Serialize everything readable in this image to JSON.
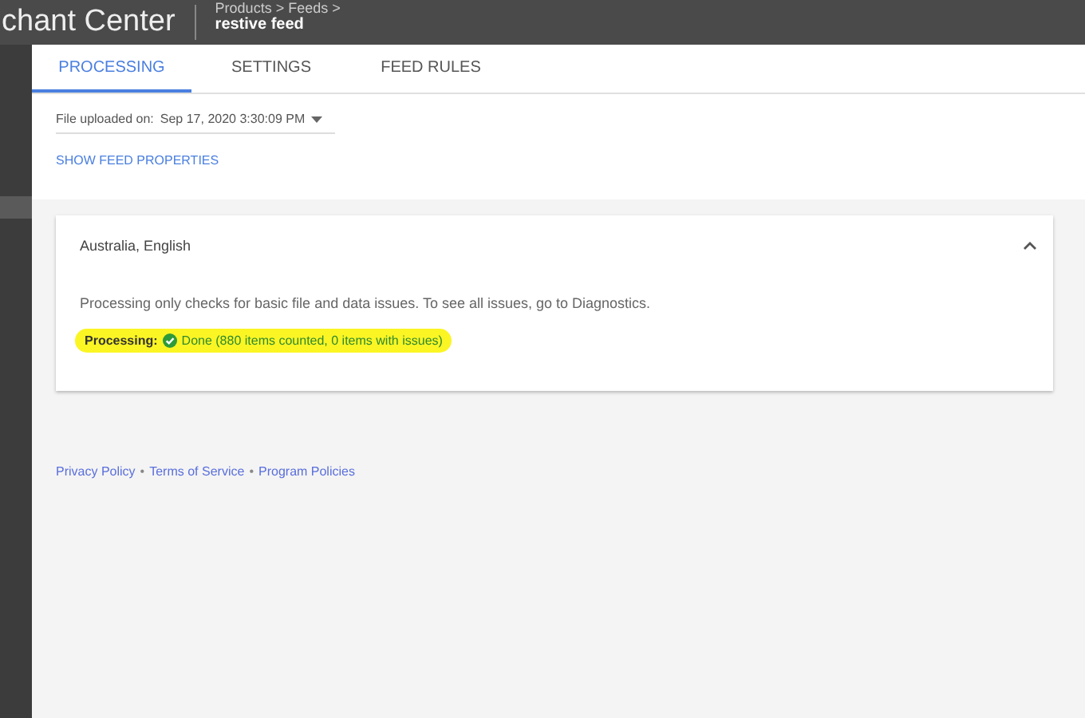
{
  "header": {
    "title": "chant Center",
    "breadcrumb": "Products > Feeds >",
    "page": "restive feed"
  },
  "tabs": [
    {
      "label": "PROCESSING",
      "selected": true
    },
    {
      "label": "SETTINGS",
      "selected": false
    },
    {
      "label": "FEED RULES",
      "selected": false
    }
  ],
  "upload": {
    "label": "File uploaded on:",
    "value": "Sep 17, 2020 3:30:09 PM"
  },
  "show_properties": "SHOW FEED PROPERTIES",
  "card": {
    "title": "Australia, English",
    "expanded": true,
    "note": "Processing only checks for basic file and data issues. To see all issues, go to Diagnostics.",
    "status_label": "Processing:",
    "status": "Done (880 items counted, 0 items with issues)",
    "highlighted": true
  },
  "footer_links": [
    "Privacy Policy",
    "Terms of Service",
    "Program Policies"
  ],
  "footer_separator": "•"
}
